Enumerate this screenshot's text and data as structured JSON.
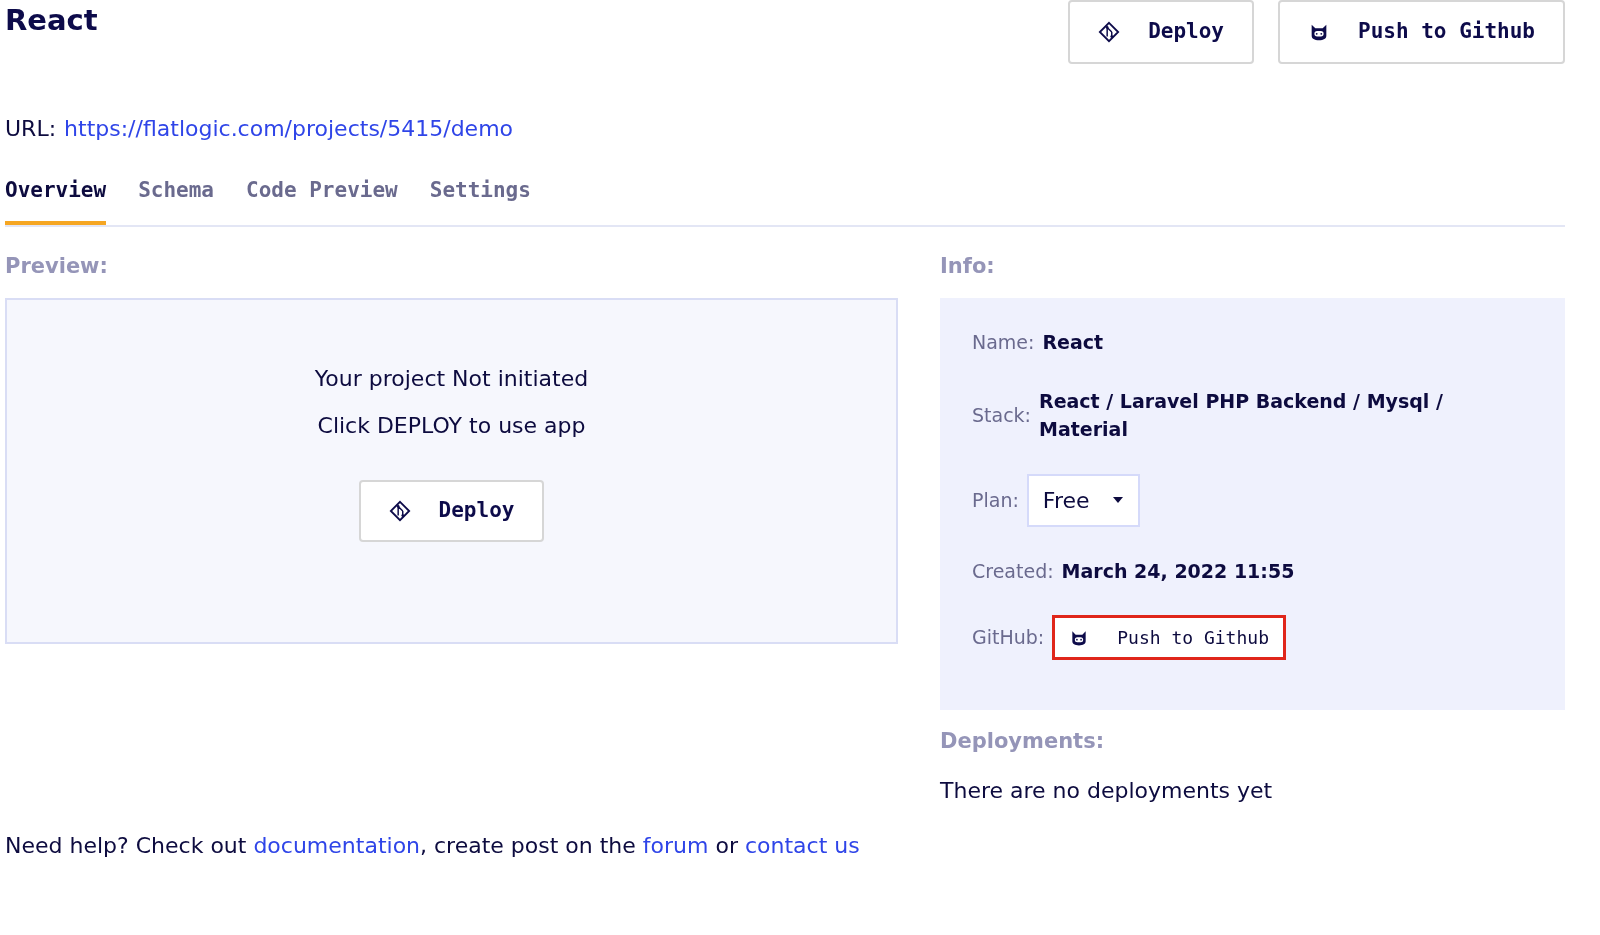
{
  "title": "React",
  "header_buttons": [
    {
      "kind": "deploy",
      "label": "Deploy"
    },
    {
      "kind": "github",
      "label": "Push to Github"
    }
  ],
  "url": {
    "label": "URL:",
    "link": "https://flatlogic.com/projects/5415/demo"
  },
  "tabs": [
    {
      "label": "Overview",
      "selected": true
    },
    {
      "label": "Schema",
      "selected": false
    },
    {
      "label": "Code Preview",
      "selected": false
    },
    {
      "label": "Settings",
      "selected": false
    }
  ],
  "preview": {
    "heading": "Preview:",
    "lines": [
      "Your project Not initiated",
      "Click DEPLOY to use app"
    ],
    "button": "Deploy"
  },
  "info": {
    "heading": "Info:",
    "rows": [
      {
        "kind": "text",
        "label": "Name:",
        "value": "React"
      },
      {
        "kind": "text",
        "label": "Stack:",
        "value": "React / Laravel PHP Backend / Mysql / Material"
      },
      {
        "kind": "select",
        "label": "Plan:",
        "value": "Free"
      },
      {
        "kind": "text",
        "label": "Created:",
        "value": "March 24, 2022 11:55"
      },
      {
        "kind": "button",
        "label": "GitHub:",
        "value": "Push to Github",
        "highlighted": true
      }
    ]
  },
  "deployments": {
    "heading": "Deployments:",
    "text": "There are no deployments yet"
  },
  "help": [
    {
      "kind": "text",
      "text": "Need help? Check out "
    },
    {
      "kind": "link",
      "text": "documentation"
    },
    {
      "kind": "text",
      "text": ", create post on the "
    },
    {
      "kind": "link",
      "text": "forum"
    },
    {
      "kind": "text",
      "text": " or "
    },
    {
      "kind": "link",
      "text": "contact us"
    }
  ]
}
